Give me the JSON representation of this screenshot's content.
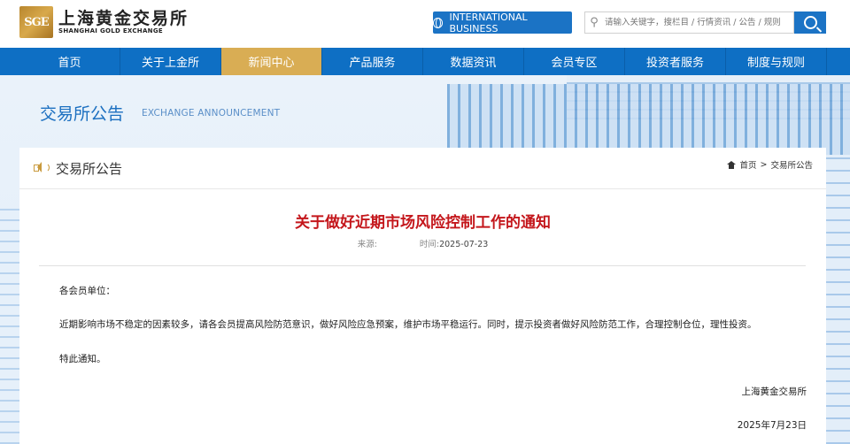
{
  "logo": {
    "mark": "SGE",
    "cn": "上海黄金交易所",
    "en": "SHANGHAI GOLD EXCHANGE"
  },
  "header": {
    "intl_label": "INTERNATIONAL BUSINESS",
    "search_placeholder": "请输入关键字，搜栏目 / 行情资讯 / 公告 / 规则"
  },
  "nav": {
    "items": [
      "首页",
      "关于上金所",
      "新闻中心",
      "产品服务",
      "数据资讯",
      "会员专区",
      "投资者服务",
      "制度与规则"
    ],
    "active_index": 2
  },
  "banner": {
    "title": "交易所公告",
    "subtitle": "EXCHANGE ANNOUNCEMENT"
  },
  "panel": {
    "title": "交易所公告",
    "breadcrumb": {
      "home": "首页",
      "sep": ">",
      "current": "交易所公告"
    }
  },
  "article": {
    "title": "关于做好近期市场风险控制工作的通知",
    "source_label": "来源:",
    "source_value": "",
    "time_label": "时间:",
    "time_value": "2025-07-23",
    "salutation": "各会员单位：",
    "body": "近期影响市场不稳定的因素较多，请各会员提高风险防范意识，做好风险应急预案，维护市场平稳运行。同时，提示投资者做好风险防范工作，合理控制仓位，理性投资。",
    "closing": "特此通知。",
    "signature": "上海黄金交易所",
    "date": "2025年7月23日"
  },
  "colors": {
    "brand_blue": "#0e6fc4",
    "active_gold": "#d9ad54",
    "title_red": "#c4171c"
  }
}
